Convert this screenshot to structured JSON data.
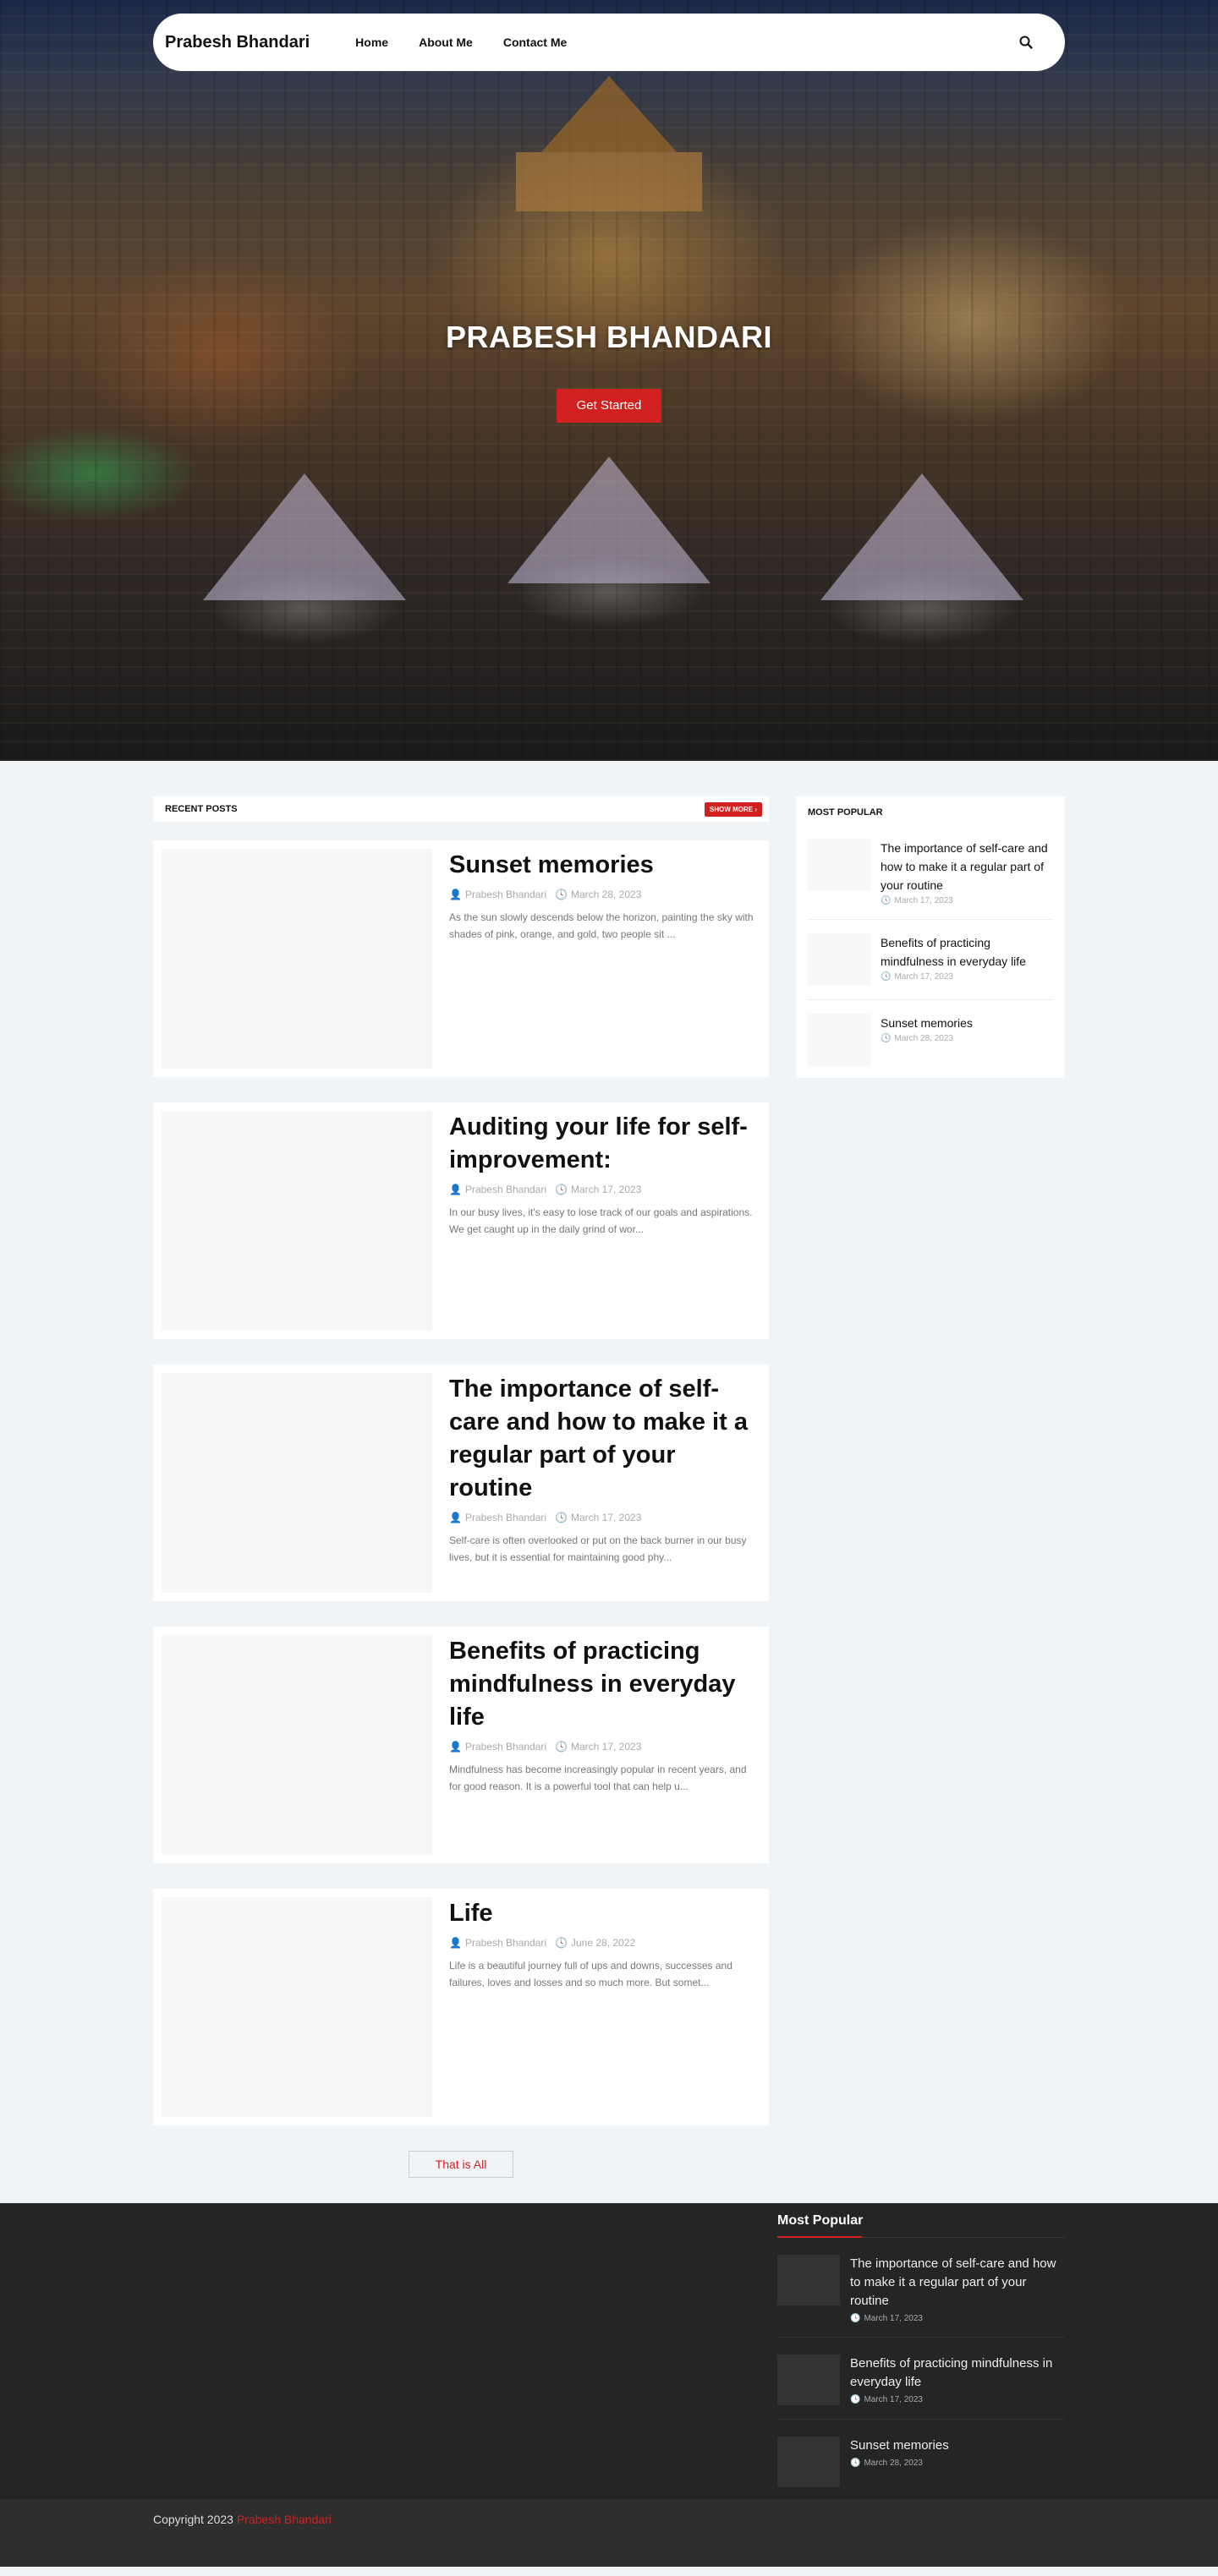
{
  "nav": {
    "brand": "Prabesh Bhandari",
    "links": [
      "Home",
      "About Me",
      "Contact Me"
    ],
    "search_icon": "search-icon"
  },
  "hero": {
    "title": "PRABESH BHANDARI",
    "button": "Get Started"
  },
  "recent": {
    "title": "RECENT POSTS",
    "show_more": "SHOW MORE",
    "posts": [
      {
        "title": "Sunset memories",
        "author": "Prabesh Bhandari",
        "date": "March 28, 2023",
        "excerpt": "As the sun slowly descends below the horizon, painting the sky with shades of pink, orange, and gold, two people sit ..."
      },
      {
        "title": "Auditing your life for self-improvement:",
        "author": "Prabesh Bhandari",
        "date": "March 17, 2023",
        "excerpt": "In our busy lives, it's easy to lose track of our goals and aspirations. We get caught up in the daily grind of wor..."
      },
      {
        "title": "The importance of self-care and how to make it a regular part of your routine",
        "author": "Prabesh Bhandari",
        "date": "March 17, 2023",
        "excerpt": "Self-care is often overlooked or put on the back burner in our busy lives, but it is essential for maintaining good phy..."
      },
      {
        "title": "Benefits of practicing mindfulness in everyday life",
        "author": "Prabesh Bhandari",
        "date": "March 17, 2023",
        "excerpt": "Mindfulness has become increasingly popular in recent years, and for good reason. It is a powerful tool that can help u..."
      },
      {
        "title": "Life",
        "author": "Prabesh Bhandari",
        "date": "June 28, 2022",
        "excerpt": "Life is a beautiful journey full of ups and downs, successes and failures, loves and losses and so much more. But somet..."
      }
    ],
    "end_button": "That is All"
  },
  "sidebar": {
    "title": "MOST POPULAR",
    "items": [
      {
        "title": "The importance of self-care and how to make it a regular part of your routine",
        "date": "March 17, 2023"
      },
      {
        "title": "Benefits of practicing mindfulness in everyday life",
        "date": "March 17, 2023"
      },
      {
        "title": "Sunset memories",
        "date": "March 28, 2023"
      }
    ]
  },
  "footer": {
    "title": "Most Popular",
    "items": [
      {
        "title": "The importance of self-care and how to make it a regular part of your routine",
        "date": "March 17, 2023"
      },
      {
        "title": "Benefits of practicing mindfulness in everyday life",
        "date": "March 17, 2023"
      },
      {
        "title": "Sunset memories",
        "date": "March 28, 2023"
      }
    ],
    "copyright_prefix": "Copyright 2023",
    "copyright_link": "Prabesh Bhandari"
  },
  "colors": {
    "accent": "#d02020",
    "page_bg": "#f1f4f7",
    "footer_bg": "#252525"
  }
}
